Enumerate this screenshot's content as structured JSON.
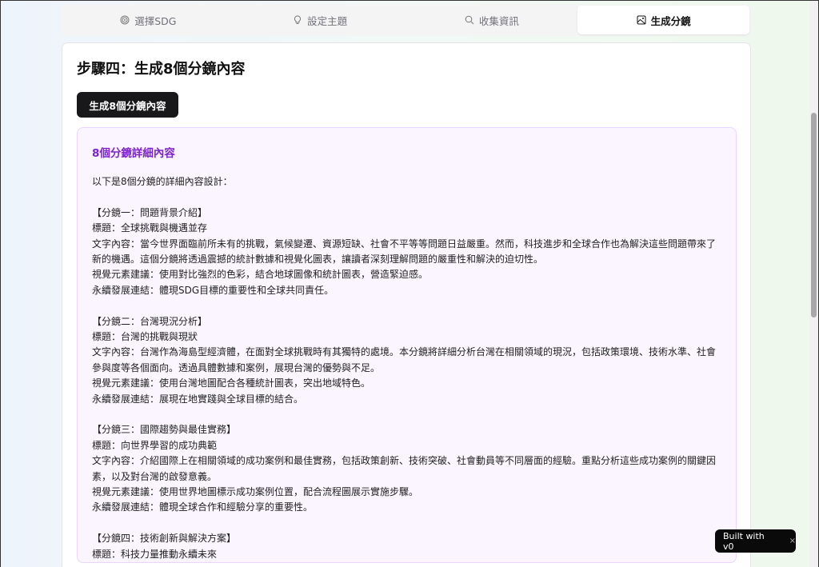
{
  "tabs": [
    {
      "label": "選擇SDG",
      "icon": "target-icon"
    },
    {
      "label": "設定主題",
      "icon": "lightbulb-icon"
    },
    {
      "label": "收集資訊",
      "icon": "search-icon"
    },
    {
      "label": "生成分鏡",
      "icon": "image-icon",
      "active": true
    }
  ],
  "step_title": "步驟四：生成8個分鏡內容",
  "generate_button": "生成8個分鏡內容",
  "result": {
    "heading": "8個分鏡詳細內容",
    "lines": [
      "以下是8個分鏡的詳細內容設計：",
      "",
      "【分鏡一：問題背景介紹】",
      "標題：全球挑戰與機遇並存",
      "文字內容：當今世界面臨前所未有的挑戰，氣候變遷、資源短缺、社會不平等等問題日益嚴重。然而，科技進步和全球合作也為解決這些問題帶來了",
      "新的機遇。這個分鏡將透過震撼的統計數據和視覺化圖表，讓讀者深刻理解問題的嚴重性和解決的迫切性。",
      "視覺元素建議：使用對比強烈的色彩，結合地球圖像和統計圖表，營造緊迫感。",
      "永續發展連結：體現SDG目標的重要性和全球共同責任。",
      "",
      "【分鏡二：台灣現況分析】",
      "標題：台灣的挑戰與現狀",
      "文字內容：台灣作為海島型經濟體，在面對全球挑戰時有其獨特的處境。本分鏡將詳細分析台灣在相關領域的現況，包括政策環境、技術水準、社會",
      "參與度等各個面向。透過具體數據和案例，展現台灣的優勢與不足。",
      "視覺元素建議：使用台灣地圖配合各種統計圖表，突出地域特色。",
      "永續發展連結：展現在地實踐與全球目標的結合。",
      "",
      "【分鏡三：國際趨勢與最佳實務】",
      "標題：向世界學習的成功典範",
      "文字內容：介紹國際上在相關領域的成功案例和最佳實務，包括政策創新、技術突破、社會動員等不同層面的經驗。重點分析這些成功案例的關鍵因",
      "素，以及對台灣的啟發意義。",
      "視覺元素建議：使用世界地圖標示成功案例位置，配合流程圖展示實施步驟。",
      "永續發展連結：體現全球合作和經驗分享的重要性。",
      "",
      "【分鏡四：技術創新與解決方案】",
      "標題：科技力量推動永續未來"
    ]
  },
  "badge": {
    "label": "Built with v0",
    "close": "×"
  }
}
